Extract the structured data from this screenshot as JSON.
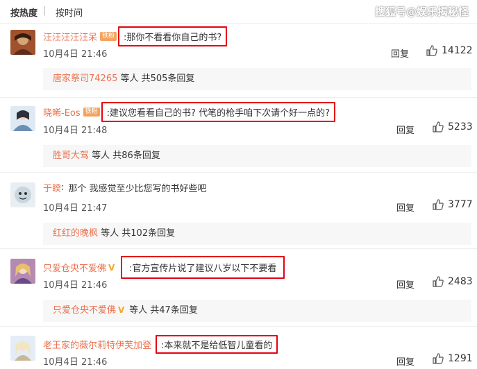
{
  "header": {
    "sort_hot": "按热度",
    "sort_separator": "|",
    "sort_time": "按时间",
    "watermark": "搜狐号@娱乐揭秘怪"
  },
  "comments": [
    {
      "username": "汪汪汪汪汪呆",
      "badge": "铁粉",
      "text": "那你不看看你自己的书?",
      "time": "10月4日 21:46",
      "reply": "回复",
      "likes": "14122",
      "sub_user": "唐家祭司74265",
      "sub_rest": " 等人 共505条回复",
      "avatar_color": "#a0522d"
    },
    {
      "username": "晓晞-Eos",
      "badge": "铁粉",
      "text": "建议您看看自己的书? 代笔的枪手咱下次请个好一点的?",
      "time": "10月4日 21:48",
      "reply": "回复",
      "likes": "5233",
      "sub_user": "胜哥大驾",
      "sub_rest": " 等人 共86条回复",
      "avatar_color": "#6a8fb5"
    },
    {
      "username": "于睽",
      "badge": "",
      "text": "那个 我感觉至少比您写的书好些吧",
      "time": "10月4日 21:47",
      "reply": "回复",
      "likes": "3777",
      "sub_user": "红红的晚枫",
      "sub_rest": " 等人 共102条回复",
      "avatar_color": "#c9d6df"
    },
    {
      "username": "只爱仓央不爱佛",
      "badge": "",
      "text": "官方宣传片说了建议八岁以下不要看",
      "time": "10月4日 21:46",
      "reply": "回复",
      "likes": "2483",
      "sub_user": "只爱仓央不爱佛",
      "sub_rest": " 等人 共47条回复",
      "avatar_color": "#b58ab0"
    },
    {
      "username": "老王家的薇尔莉特伊芙加登",
      "badge": "",
      "text": "本来就不是给低智儿童看的",
      "time": "10月4日 21:46",
      "reply": "回复",
      "likes": "1291",
      "sub_user": "",
      "sub_rest": "",
      "avatar_color": "#c8b89a"
    }
  ],
  "colors": {
    "username": "#eb7350",
    "highlight_box": "#e60012",
    "sub_bg": "#f7f7f7"
  }
}
